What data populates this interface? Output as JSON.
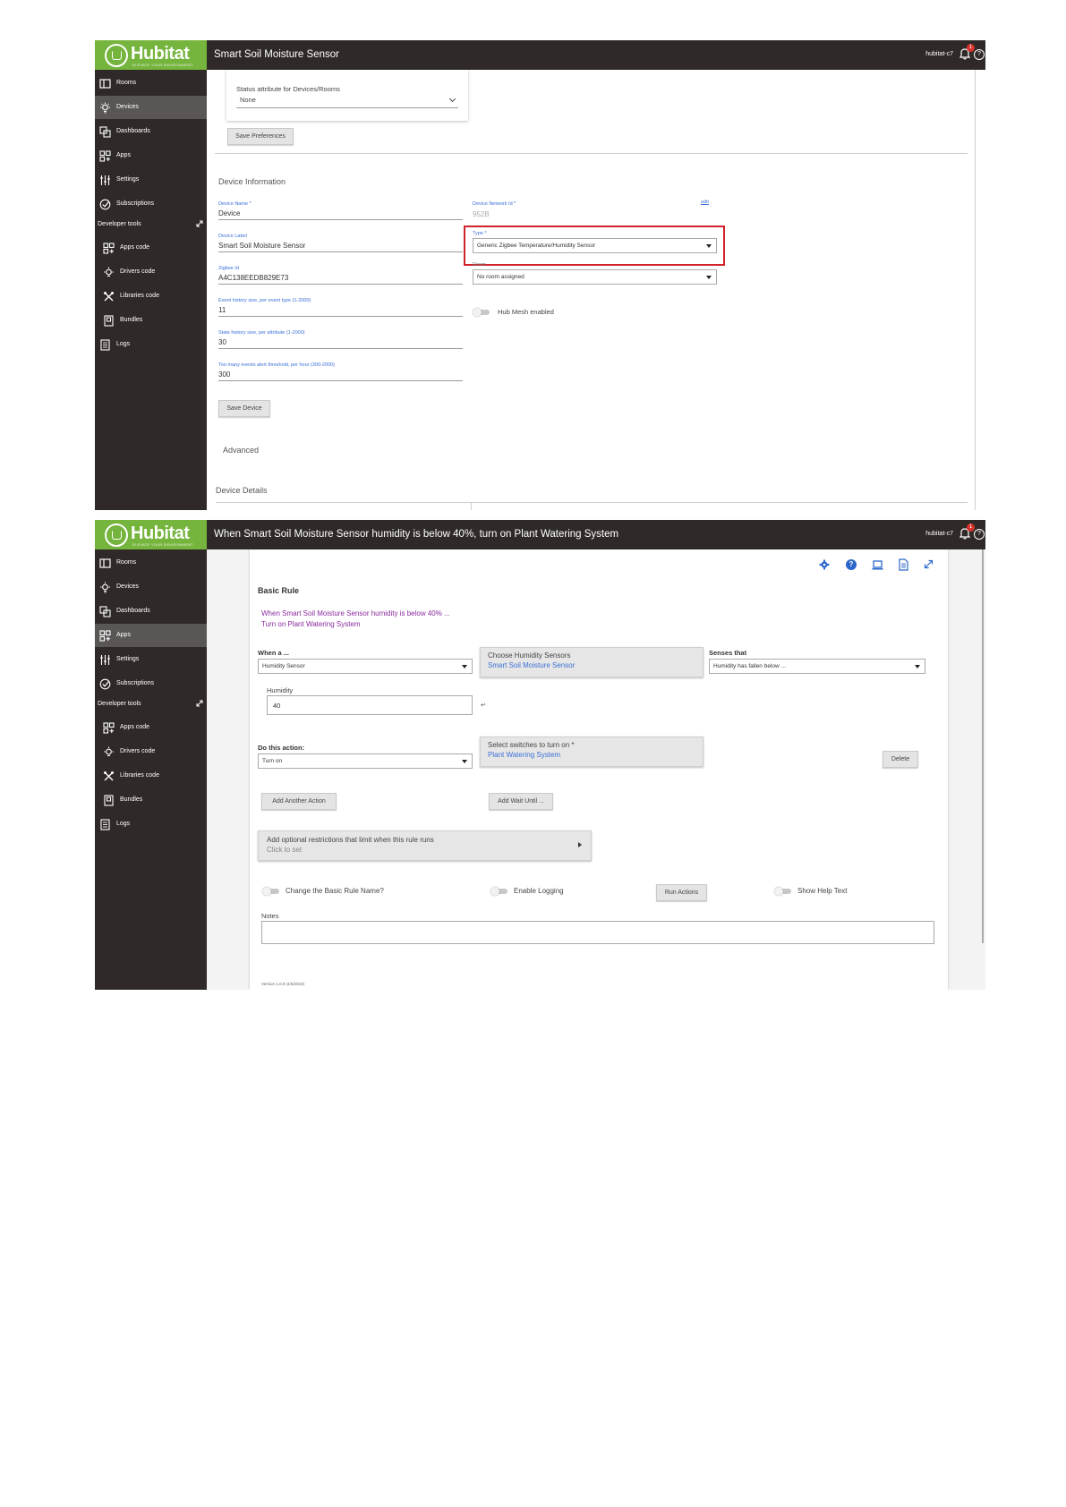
{
  "app": {
    "brand": "Hubitat",
    "brand_tagline": "ELEVATE YOUR ENVIRONMENT",
    "hub_name": "hubitat-c7",
    "notification_count": "1",
    "brand_green": "#75b43d",
    "topbar_color": "#2f2a28"
  },
  "sidebar": {
    "items": [
      {
        "label": "Rooms",
        "icon": "rooms-icon"
      },
      {
        "label": "Devices",
        "icon": "devices-icon"
      },
      {
        "label": "Dashboards",
        "icon": "dashboards-icon"
      },
      {
        "label": "Apps",
        "icon": "apps-icon"
      },
      {
        "label": "Settings",
        "icon": "settings-icon"
      },
      {
        "label": "Subscriptions",
        "icon": "subscriptions-icon"
      }
    ],
    "dev_header": "Developer tools",
    "dev_items": [
      {
        "label": "Apps code",
        "icon": "apps-code-icon"
      },
      {
        "label": "Drivers code",
        "icon": "drivers-code-icon"
      },
      {
        "label": "Libraries code",
        "icon": "libraries-code-icon"
      },
      {
        "label": "Bundles",
        "icon": "bundles-icon"
      },
      {
        "label": "Logs",
        "icon": "logs-icon"
      }
    ]
  },
  "screen1": {
    "title": "Smart Soil Moisture Sensor",
    "active_item": "Devices",
    "status_attr_label": "Status attribute for Devices/Rooms",
    "status_attr_value": "None",
    "save_prefs_label": "Save Preferences",
    "section_title": "Device Information",
    "device_name_label": "Device Name *",
    "device_name_value": "Device",
    "dni_label": "Device Network Id *",
    "dni_value": "952B",
    "edit_label": "edit",
    "device_label_label": "Device Label",
    "device_label_value": "Smart Soil Moisture Sensor",
    "type_label": "Type *",
    "type_value": "Generic Zigbee Temperature/Humidity Sensor",
    "zigbee_label": "Zigbee Id",
    "zigbee_value": "A4C138EEDB829E73",
    "room_label": "Room",
    "room_value": "No room assigned",
    "event_hist_label": "Event history size, per event type (1-2000)",
    "event_hist_value": "11",
    "hub_mesh_label": "Hub Mesh enabled",
    "state_hist_label": "State history size, per attribute (1-2000)",
    "state_hist_value": "30",
    "too_many_label": "Too many events alert threshold, per hour (300-2000)",
    "too_many_value": "300",
    "save_device_label": "Save Device",
    "advanced_label": "Advanced",
    "device_details_label": "Device Details",
    "highlight_color": "#d0222a"
  },
  "screen2": {
    "title": "When Smart Soil Moisture Sensor humidity is below 40%, turn on Plant Watering System",
    "active_item": "Apps",
    "rule_title": "Basic Rule",
    "summary_line1": "When Smart Soil Moisture Sensor humidity is below 40% ...",
    "summary_line2": "Turn on Plant Watering System",
    "when_label": "When a ...",
    "when_value": "Humidity Sensor",
    "choose_sensors_label": "Choose Humidity Sensors",
    "choose_sensors_value": "Smart Soil Moisture Sensor",
    "senses_label": "Senses that",
    "senses_value": "Humidity has fallen below ...",
    "humidity_label": "Humidity",
    "humidity_value": "40",
    "action_label": "Do this action:",
    "action_value": "Turn on",
    "switches_label": "Select switches to turn on *",
    "switches_value": "Plant Watering System",
    "delete_label": "Delete",
    "add_action_label": "Add Another Action",
    "add_wait_label": "Add Wait Until ...",
    "restrictions_label": "Add optional restrictions that limit when this rule runs",
    "restrictions_sub": "Click to set",
    "change_name_label": "Change the Basic Rule Name?",
    "enable_logging_label": "Enable Logging",
    "run_actions_label": "Run Actions",
    "show_help_label": "Show Help Text",
    "notes_label": "Notes",
    "version_label": "Version 1.0.9 (4/5/2023)"
  }
}
